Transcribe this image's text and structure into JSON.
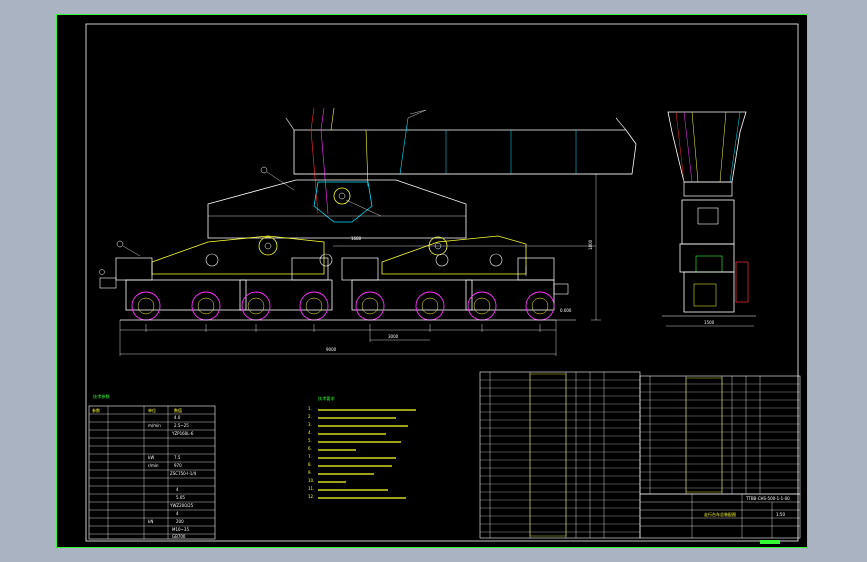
{
  "dimensions": {
    "overall_length": "9000",
    "wheelbase": "3000",
    "axle_spacing": "1680",
    "height": "1800",
    "front_width": "1500",
    "rail_level": "0.000"
  },
  "title_block": {
    "drawing_code": "TTBB-CHS-500-1-1-00",
    "drawing_title": "走行台车总装配图",
    "scale": "1:50"
  },
  "params_table": {
    "title": "技术参数",
    "header": [
      "参数",
      "单位",
      "数值"
    ],
    "rows": [
      [
        "",
        "",
        "4.0"
      ],
      [
        "",
        "m/min",
        "2.5~25"
      ],
      [
        "",
        "",
        "YZP160L-6"
      ],
      [
        "",
        "kW",
        "7.5"
      ],
      [
        "",
        "r/min",
        "970"
      ],
      [
        "",
        "",
        "ZSC750-I-1/4"
      ],
      [
        "",
        "",
        "4"
      ],
      [
        "",
        "",
        "5.05"
      ],
      [
        "",
        "",
        "YWZ200/25"
      ],
      [
        "",
        "",
        "4"
      ],
      [
        "",
        "kN",
        "200"
      ],
      [
        "",
        "",
        "M10~35"
      ],
      [
        "",
        "",
        "GB700"
      ]
    ]
  },
  "notes": {
    "heading": "技术要求",
    "lines": [
      "1.",
      "2.",
      "3.",
      "4.",
      "5.",
      "6.",
      "7.",
      "8.",
      "9.",
      "10.",
      "11.",
      "12."
    ]
  },
  "colors": {
    "background": "#000000",
    "outline": "#ffffff",
    "frame": "#33ff33",
    "accent_cyan": "#00e5ff",
    "accent_yellow": "#ffff33",
    "accent_red": "#ff3030",
    "accent_magenta": "#ff33ff"
  }
}
